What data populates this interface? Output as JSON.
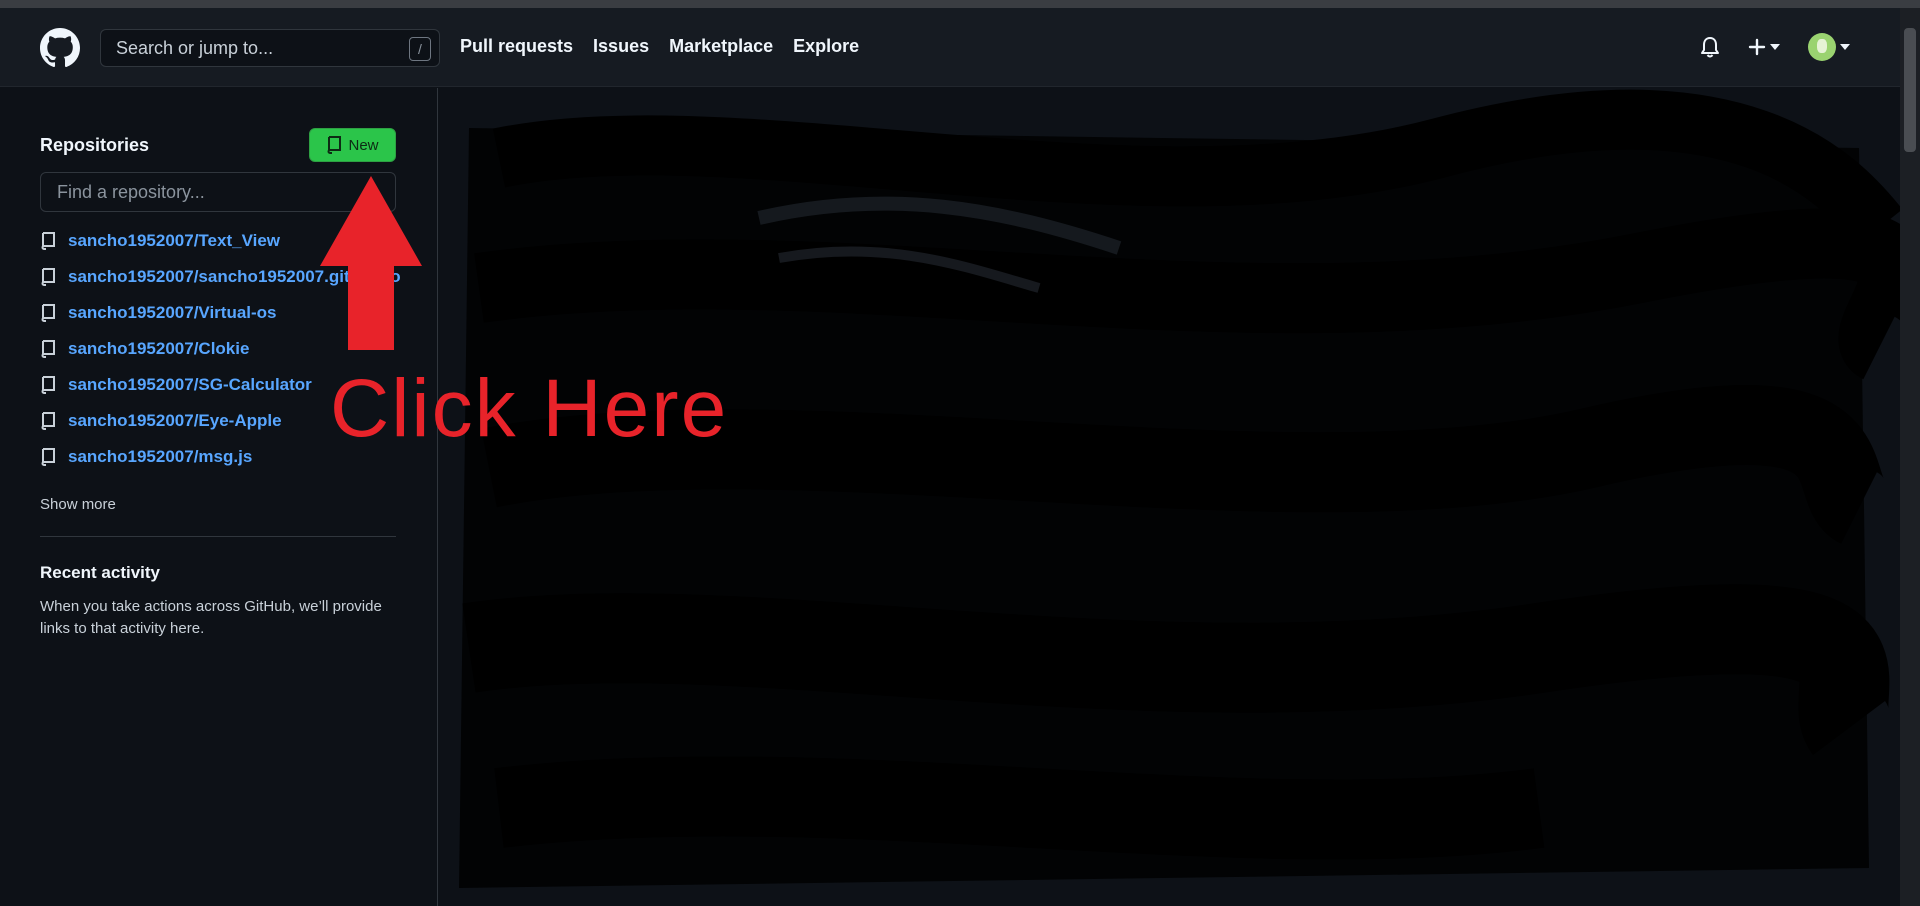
{
  "header": {
    "search_placeholder": "Search or jump to...",
    "search_shortcut": "/",
    "nav": [
      "Pull requests",
      "Issues",
      "Marketplace",
      "Explore"
    ]
  },
  "sidebar": {
    "title": "Repositories",
    "new_button": "New",
    "find_placeholder": "Find a repository...",
    "repos": [
      "sancho1952007/Text_View",
      "sancho1952007/sancho1952007.github.io",
      "sancho1952007/Virtual-os",
      "sancho1952007/Clokie",
      "sancho1952007/SG-Calculator",
      "sancho1952007/Eye-Apple",
      "sancho1952007/msg.js"
    ],
    "show_more": "Show more",
    "recent_title": "Recent activity",
    "recent_text": "When you take actions across GitHub, we’ll provide links to that activity here."
  },
  "annotation": {
    "text": "Click Here",
    "color": "#e8232a"
  },
  "colors": {
    "header_bg": "#161b22",
    "page_bg": "#0d1117",
    "link": "#58a6ff",
    "new_button": "#2bc54a"
  }
}
